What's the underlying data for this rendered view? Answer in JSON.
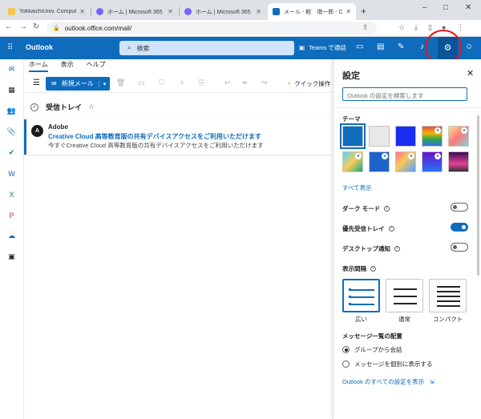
{
  "browser": {
    "tabs": [
      {
        "title": "YokkaichiUniv. Compute",
        "favicon_color": "#f2c94c",
        "active": false
      },
      {
        "title": "ホーム | Microsoft 365",
        "favicon_color": "#7b61ff",
        "active": false
      },
      {
        "title": "ホーム | Microsoft 365",
        "favicon_color": "#7b61ff",
        "active": false
      },
      {
        "title": "メール - 鮫　増一郎 - Out",
        "favicon_color": "#0f6cbd",
        "active": true
      }
    ],
    "new_tab_glyph": "+",
    "url": "outlook.office.com/mail/",
    "window_controls": [
      "–",
      "□",
      "✕"
    ]
  },
  "outlook": {
    "brand": "Outlook",
    "search_placeholder": "検索",
    "teams_label": "Teams で通話",
    "accent": "#0f6cbd"
  },
  "ribbon": {
    "tabs": [
      "ホーム",
      "表示",
      "ヘルプ"
    ],
    "new_mail_label": "新規メール",
    "quick_steps_label": "クイック操作"
  },
  "mail_list": {
    "folder_title": "受信トレイ",
    "messages": [
      {
        "avatar": "A",
        "sender": "Adobe",
        "subject": "Creative Cloud 高等教育版の共有デバイスアクセスをご利用いただけます",
        "preview": "今すぐCreative Cloud 高等教育版の共有デバイスアクセスをご利用いただけます"
      }
    ]
  },
  "settings": {
    "title": "設定",
    "search_placeholder": "Outlook の設定を検索します",
    "theme_label": "テーマ",
    "show_all_label": "すべて表示",
    "dark_mode_label": "ダーク モード",
    "dark_mode_on": false,
    "focused_inbox_label": "優先受信トレイ",
    "focused_inbox_on": true,
    "desktop_notif_label": "デスクトップ通知",
    "desktop_notif_on": false,
    "density_label": "表示間隔",
    "density_options": [
      "広い",
      "通常",
      "コンパクト"
    ],
    "density_selected": "広い",
    "arrangement_label": "メッセージ一覧の配置",
    "arrangement_options": [
      "グループから会話",
      "メッセージを個別に表示する"
    ],
    "arrangement_selected": "グループから会話",
    "all_settings_link": "Outlook のすべての設定を表示"
  }
}
